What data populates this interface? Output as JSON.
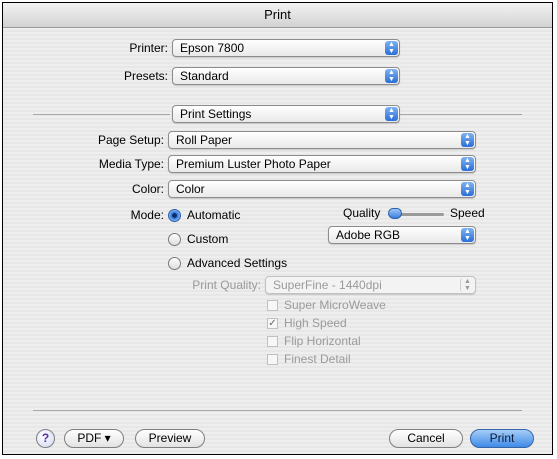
{
  "window": {
    "title": "Print"
  },
  "printer": {
    "label": "Printer:",
    "value": "Epson 7800"
  },
  "presets": {
    "label": "Presets:",
    "value": "Standard"
  },
  "panel": {
    "value": "Print Settings"
  },
  "page_setup": {
    "label": "Page Setup:",
    "value": "Roll Paper"
  },
  "media_type": {
    "label": "Media Type:",
    "value": "Premium Luster Photo Paper"
  },
  "color": {
    "label": "Color:",
    "value": "Color"
  },
  "mode": {
    "label": "Mode:",
    "options": [
      "Automatic",
      "Custom",
      "Advanced Settings"
    ],
    "selected": "Automatic"
  },
  "quality_slider": {
    "left_label": "Quality",
    "right_label": "Speed",
    "level": 0.0
  },
  "color_space": {
    "value": "Adobe RGB"
  },
  "print_quality": {
    "label": "Print Quality:",
    "value": "SuperFine - 1440dpi"
  },
  "checkboxes": [
    {
      "label": "Super MicroWeave",
      "checked": false
    },
    {
      "label": "High Speed",
      "checked": true
    },
    {
      "label": "Flip Horizontal",
      "checked": false
    },
    {
      "label": "Finest Detail",
      "checked": false
    }
  ],
  "buttons": {
    "help": "?",
    "pdf": "PDF ▾",
    "preview": "Preview",
    "cancel": "Cancel",
    "print": "Print"
  }
}
